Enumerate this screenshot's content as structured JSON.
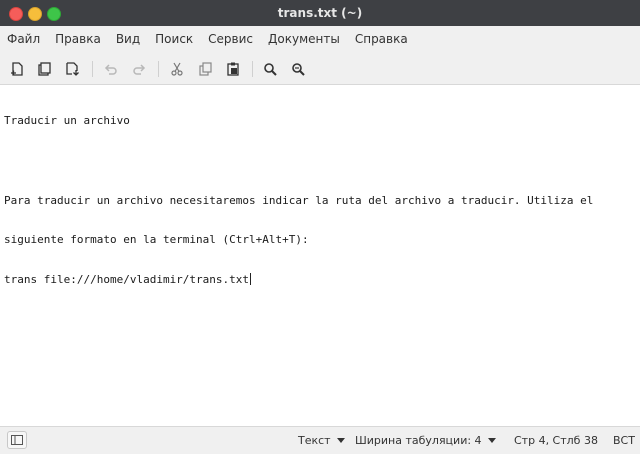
{
  "window": {
    "title": "trans.txt (~)"
  },
  "menu": [
    "Файл",
    "Правка",
    "Вид",
    "Поиск",
    "Сервис",
    "Документы",
    "Справка"
  ],
  "toolbar": {
    "icons": [
      "new-document-icon",
      "open-document-icon",
      "save-document-icon",
      "undo-icon",
      "redo-icon",
      "cut-icon",
      "copy-icon",
      "paste-icon",
      "find-icon",
      "find-replace-icon"
    ]
  },
  "editor": {
    "lines": [
      "Traducir un archivo",
      "",
      "Para traducir un archivo necesitaremos indicar la ruta del archivo a traducir. Utiliza el",
      "siguiente formato en la terminal (Ctrl+Alt+T):",
      "trans file:///home/vladimir/trans.txt"
    ]
  },
  "status": {
    "language": "Текст",
    "tab_width": "Ширина табуляции:  4",
    "position": "Стр 4, Стлб 38",
    "mode": "ВСТ"
  }
}
